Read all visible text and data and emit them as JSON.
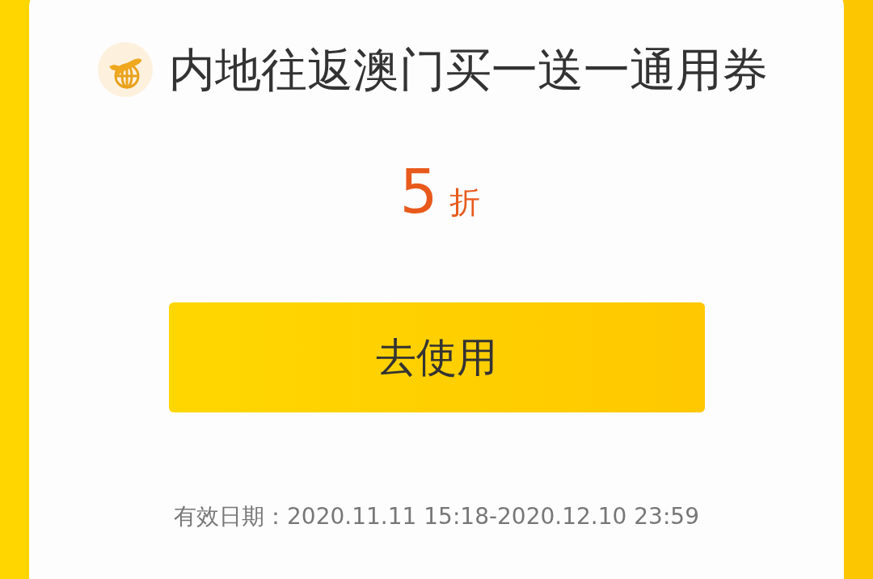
{
  "coupon": {
    "title": "内地往返澳门买一送一通用券",
    "discount": {
      "value": "5",
      "unit": "折"
    },
    "button": "去使用",
    "validity": "有效日期：2020.11.11 15:18-2020.12.10 23:59"
  }
}
